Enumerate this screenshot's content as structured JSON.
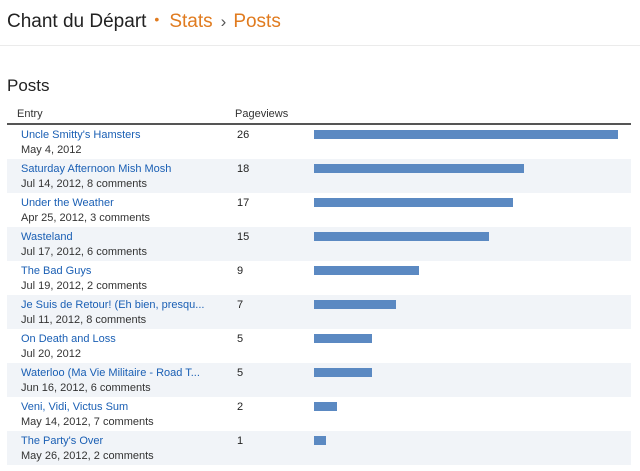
{
  "header": {
    "blog_name": "Chant du Départ",
    "sep_dot": "•",
    "crumb_stats": "Stats",
    "sep_arrow": "›",
    "crumb_posts": "Posts"
  },
  "section_title": "Posts",
  "table": {
    "col_entry": "Entry",
    "col_views": "Pageviews",
    "max_views": 26,
    "bar_color": "#5b89c2",
    "rows": [
      {
        "title": "Uncle Smitty's Hamsters",
        "meta": "May 4, 2012",
        "views": 26
      },
      {
        "title": "Saturday Afternoon Mish Mosh",
        "meta": "Jul 14, 2012, 8 comments",
        "views": 18
      },
      {
        "title": "Under the Weather",
        "meta": "Apr 25, 2012, 3 comments",
        "views": 17
      },
      {
        "title": "Wasteland",
        "meta": "Jul 17, 2012, 6 comments",
        "views": 15
      },
      {
        "title": "The Bad Guys",
        "meta": "Jul 19, 2012, 2 comments",
        "views": 9
      },
      {
        "title": "Je Suis de Retour! (Eh bien, presqu...",
        "meta": "Jul 11, 2012, 8 comments",
        "views": 7
      },
      {
        "title": "On Death and Loss",
        "meta": "Jul 20, 2012",
        "views": 5
      },
      {
        "title": "Waterloo (Ma Vie Militaire - Road T...",
        "meta": "Jun 16, 2012, 6 comments",
        "views": 5
      },
      {
        "title": "Veni, Vidi, Victus Sum",
        "meta": "May 14, 2012, 7 comments",
        "views": 2
      },
      {
        "title": "The Party's Over",
        "meta": "May 26, 2012, 2 comments",
        "views": 1
      }
    ]
  }
}
